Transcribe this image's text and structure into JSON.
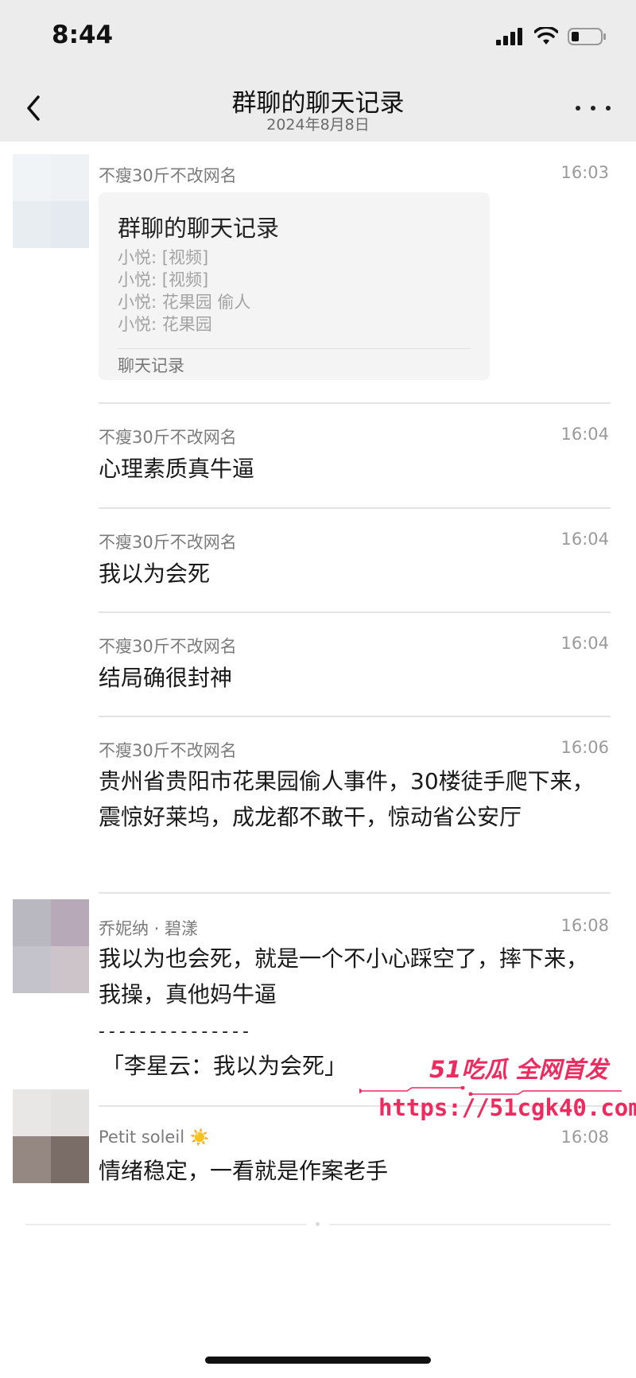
{
  "status": {
    "time": "8:44"
  },
  "nav": {
    "title": "群聊的聊天记录",
    "subtitle": "2024年8月8日",
    "back_icon": "chevron-left-icon",
    "more_icon": "more-dots-icon"
  },
  "messages": [
    {
      "sender": "不瘦30斤不改网名",
      "time": "16:03",
      "card": {
        "title": "群聊的聊天记录",
        "lines": [
          "小悦: [视频]",
          "小悦: [视频]",
          "小悦: 花果园 偷人",
          "小悦: 花果园"
        ],
        "footer": "聊天记录"
      }
    },
    {
      "sender": "不瘦30斤不改网名",
      "time": "16:04",
      "text": "心理素质真牛逼"
    },
    {
      "sender": "不瘦30斤不改网名",
      "time": "16:04",
      "text": "我以为会死"
    },
    {
      "sender": "不瘦30斤不改网名",
      "time": "16:04",
      "text": "结局确很封神"
    },
    {
      "sender": "不瘦30斤不改网名",
      "time": "16:06",
      "text": "贵州省贵阳市花果园偷人事件，30楼徒手爬下来，震惊好莱坞，成龙都不敢干，惊动省公安厅"
    },
    {
      "sender": "乔妮纳 · 碧漾",
      "time": "16:08",
      "text": "我以为也会死，就是一个不小心踩空了，摔下来，我操，真他妈牛逼",
      "quote_separator": "- - - - - - - - - - - - - - -",
      "quote": "「李星云：我以为会死」"
    },
    {
      "sender": "Petit soleil",
      "sender_emoji": "☀️",
      "time": "16:08",
      "text": "情绪稳定，一看就是作案老手"
    }
  ],
  "watermark": {
    "line1": "51吃瓜 全网首发",
    "line2": "https://51cgk40.com"
  },
  "colors": {
    "header_bg": "#ececec",
    "watermark": "#ee2a5e"
  }
}
